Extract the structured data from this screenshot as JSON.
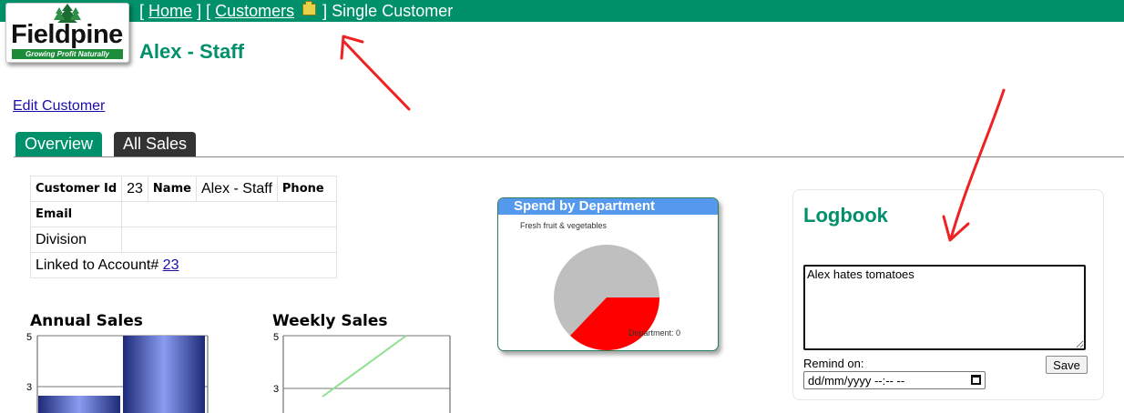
{
  "breadcrumb": {
    "open1": "[",
    "home": "Home",
    "mid": "] [",
    "customers": "Customers",
    "close": "] Single Customer"
  },
  "logo": {
    "word": "Fieldpine",
    "tagline": "Growing Profit Naturally"
  },
  "page_title": "Alex - Staff",
  "edit_link": "Edit Customer",
  "tabs": [
    {
      "label": "Overview"
    },
    {
      "label": "All Sales"
    }
  ],
  "customer": {
    "id_label": "Customer Id",
    "id_value": "23",
    "name_label": "Name",
    "name_value": "Alex - Staff",
    "phone_label": "Phone",
    "email_label": "Email",
    "division_label": "Division",
    "linked_label": "Linked to Account#",
    "linked_value": "23"
  },
  "spend_panel": {
    "title": "Spend by Department",
    "labels": {
      "top": "Fresh fruit & vegetables",
      "bottom": "Department: 0"
    },
    "colors": {
      "grey": "#bfbfbf",
      "red": "#ff0000",
      "header": "#5599ee"
    }
  },
  "logbook": {
    "title": "Logbook",
    "note": "Alex hates tomatoes",
    "remind_label": "Remind on:",
    "date_placeholder": "dd/mm/yyyy  --:-- --",
    "save_label": "Save"
  },
  "annual": {
    "title": "Annual Sales",
    "ticks": [
      "5",
      "3"
    ]
  },
  "weekly": {
    "title": "Weekly Sales",
    "ticks": [
      "5",
      "3"
    ]
  },
  "colors": {
    "brand": "#00906a",
    "tab_dark": "#333333",
    "link": "#1a0dab",
    "arrow": "#ee2222"
  }
}
